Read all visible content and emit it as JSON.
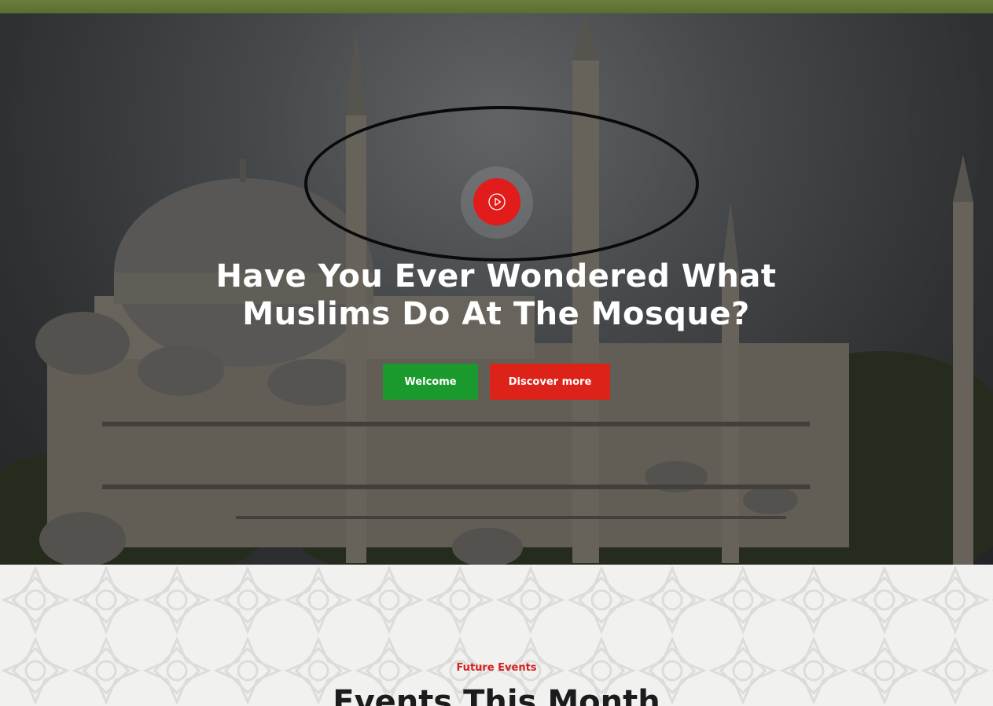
{
  "hero": {
    "title_line1": "Have You Ever Wondered What",
    "title_line2": "Muslims Do At The Mosque?",
    "play_icon": "play-circle-icon",
    "welcome_label": "Welcome",
    "discover_label": "Discover more"
  },
  "events": {
    "kicker": "Future Events",
    "title": "Events This Month"
  },
  "colors": {
    "primary_green": "#1a9a2c",
    "primary_red": "#dd2219",
    "play_red": "#e21b1b",
    "top_strip": "#5b6e2f"
  }
}
